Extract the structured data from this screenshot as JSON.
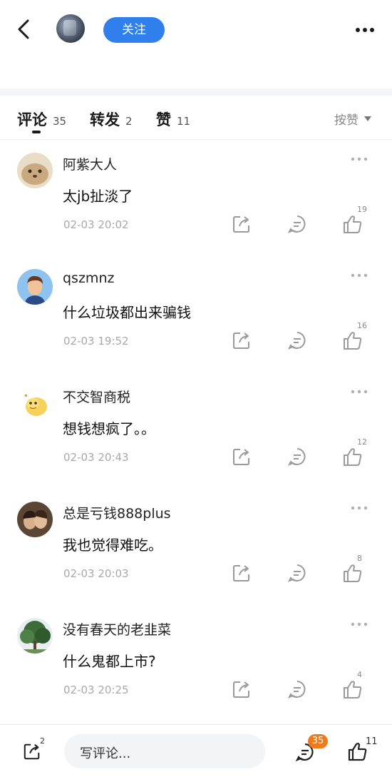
{
  "header": {
    "follow_label": "关注"
  },
  "tabs": {
    "comments": {
      "label": "评论",
      "count": "35"
    },
    "reposts": {
      "label": "转发",
      "count": "2"
    },
    "likes": {
      "label": "赞",
      "count": "11"
    },
    "sort_label": "按赞"
  },
  "comments": [
    {
      "name": "阿紫大人",
      "text": "太jb扯淡了",
      "time": "02-03 20:02",
      "likes": "19"
    },
    {
      "name": "qszmnz",
      "text": "什么垃圾都出来骗钱",
      "time": "02-03 19:52",
      "likes": "16"
    },
    {
      "name": "不交智商税",
      "text": "想钱想疯了。。",
      "time": "02-03 20:43",
      "likes": "12"
    },
    {
      "name": "总是亏钱888plus",
      "text": "我也觉得难吃。",
      "time": "02-03 20:03",
      "likes": "8"
    },
    {
      "name": "没有春天的老韭菜",
      "text": "什么鬼都上市?",
      "time": "02-03 20:25",
      "likes": "4"
    }
  ],
  "bottom_bar": {
    "share_count": "2",
    "input_placeholder": "写评论...",
    "comment_badge": "35",
    "like_count": "11"
  },
  "colors": {
    "accent": "#2f80ed",
    "badge": "#f07b1b",
    "timestamp": "#a8a8a8"
  }
}
